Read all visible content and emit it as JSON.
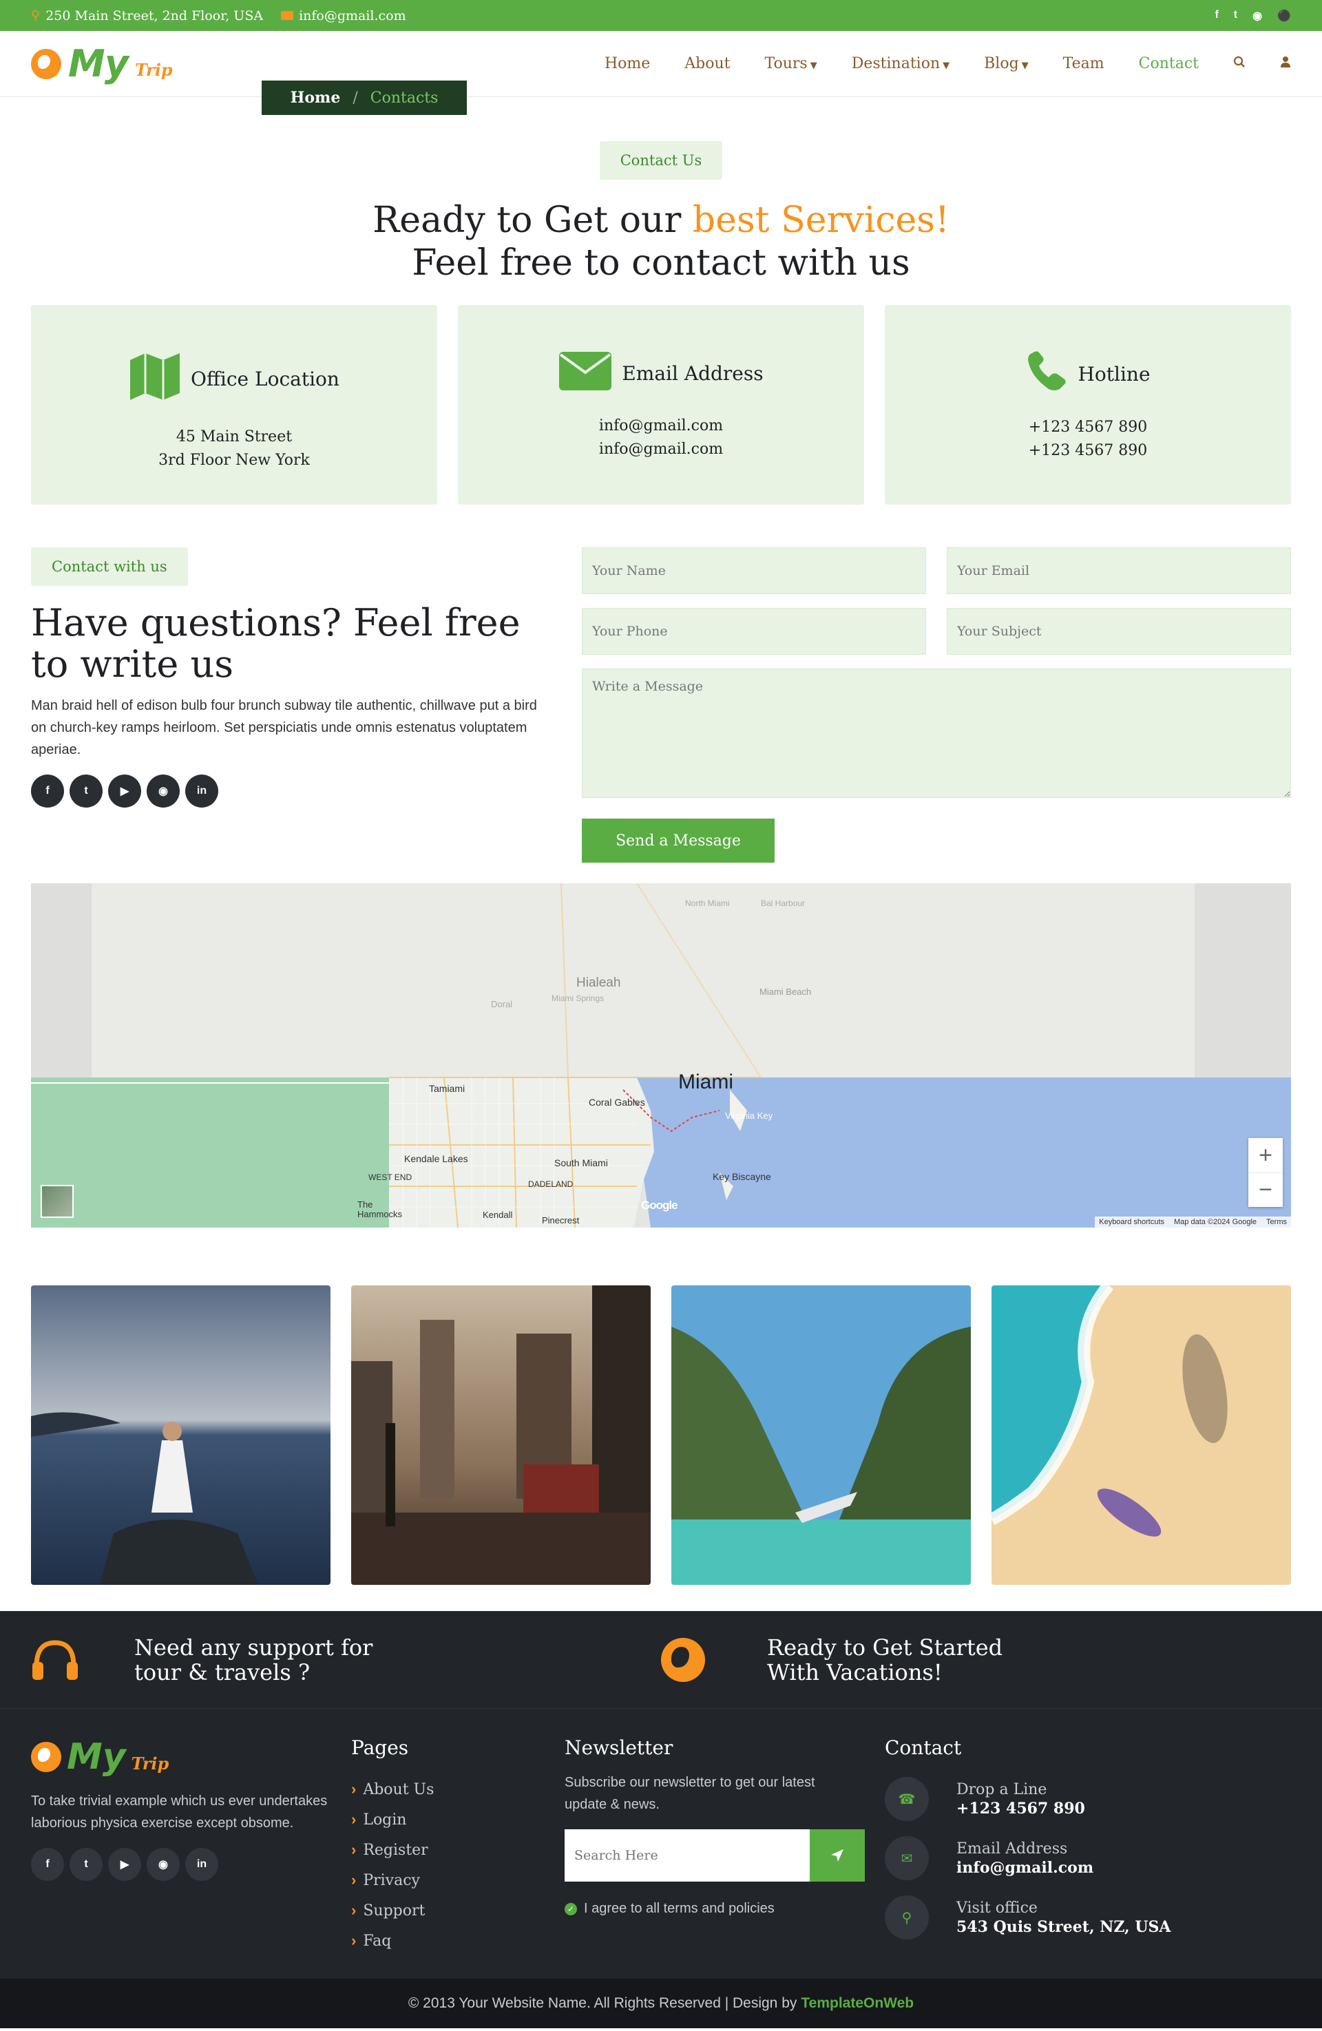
{
  "topbar": {
    "address": "250 Main Street, 2nd Floor, USA",
    "email": "info@gmail.com",
    "socials": [
      "f",
      "t",
      "ig",
      "p"
    ]
  },
  "nav": {
    "logo_main": "My",
    "logo_sub": "Trip",
    "items": [
      {
        "label": "Home"
      },
      {
        "label": "About"
      },
      {
        "label": "Tours"
      },
      {
        "label": "Destination"
      },
      {
        "label": "Blog"
      },
      {
        "label": "Team"
      },
      {
        "label": "Contact"
      }
    ]
  },
  "breadcrumb": {
    "home": "Home",
    "sep": "/",
    "current": "Contacts"
  },
  "contact_header": {
    "badge": "Contact Us",
    "title_part1": "Ready to Get our ",
    "title_highlight": "best Services!",
    "title_line2": "Feel free to contact with us"
  },
  "info_cards": [
    {
      "title": "Office Location",
      "line1": "45 Main Street",
      "line2": "3rd Floor New York"
    },
    {
      "title": "Email Address",
      "line1": "info@gmail.com",
      "line2": "info@gmail.com"
    },
    {
      "title": "Hotline",
      "line1": "+123 4567 890",
      "line2": "+123 4567 890"
    }
  ],
  "contact_form": {
    "badge": "Contact with us",
    "heading": "Have questions? Feel free to write us",
    "paragraph": "Man braid hell of edison bulb four brunch subway tile authentic, chillwave put a bird on church-key ramps heirloom. Set perspiciatis unde omnis estenatus voluptatem aperiae.",
    "name_placeholder": "Your Name",
    "email_placeholder": "Your Email",
    "phone_placeholder": "Your Phone",
    "subject_placeholder": "Your Subject",
    "message_placeholder": "Write a Message",
    "submit": "Send a Message"
  },
  "map": {
    "city": "Miami",
    "labels": [
      "Hialeah",
      "Miami Beach",
      "Coral Gables",
      "Virginia Key",
      "Key Biscayne",
      "Kendale Lakes",
      "South Miami",
      "Tamiami",
      "WEST END",
      "DADELAND",
      "The Hammocks",
      "Kendall",
      "Pinecrest",
      "Doral",
      "Miami Springs",
      "North Miami",
      "Bal Harbour"
    ],
    "attribution": "Map data ©2024 Google",
    "shortcuts": "Keyboard shortcuts",
    "terms": "Terms",
    "google": "Google"
  },
  "footer": {
    "support_text": "Need any support for tour & travels ?",
    "ready_text": "Ready to Get Started With Vacations!",
    "about": "To take trivial example which us ever undertakes laborious physica exercise except obsome.",
    "pages_title": "Pages",
    "pages": [
      "About Us",
      "Login",
      "Register",
      "Privacy",
      "Support",
      "Faq"
    ],
    "newsletter_title": "Newsletter",
    "newsletter_text": "Subscribe our newsletter to get our latest update & news.",
    "search_placeholder": "Search Here",
    "agree": "I agree to all terms and policies",
    "contact_title": "Contact",
    "contacts": [
      {
        "label": "Drop a Line",
        "value": "+123 4567 890"
      },
      {
        "label": "Email Address",
        "value": "info@gmail.com"
      },
      {
        "label": "Visit office",
        "value": "543 Quis Street, NZ, USA"
      }
    ],
    "copyright": "© 2013 Your Website Name. All Rights Reserved | Design by",
    "brand": "TemplateOnWeb"
  },
  "colors": {
    "green": "#5aad43",
    "orange": "#f7931e",
    "dark": "#22252a",
    "light_green": "#e8f3e4"
  }
}
